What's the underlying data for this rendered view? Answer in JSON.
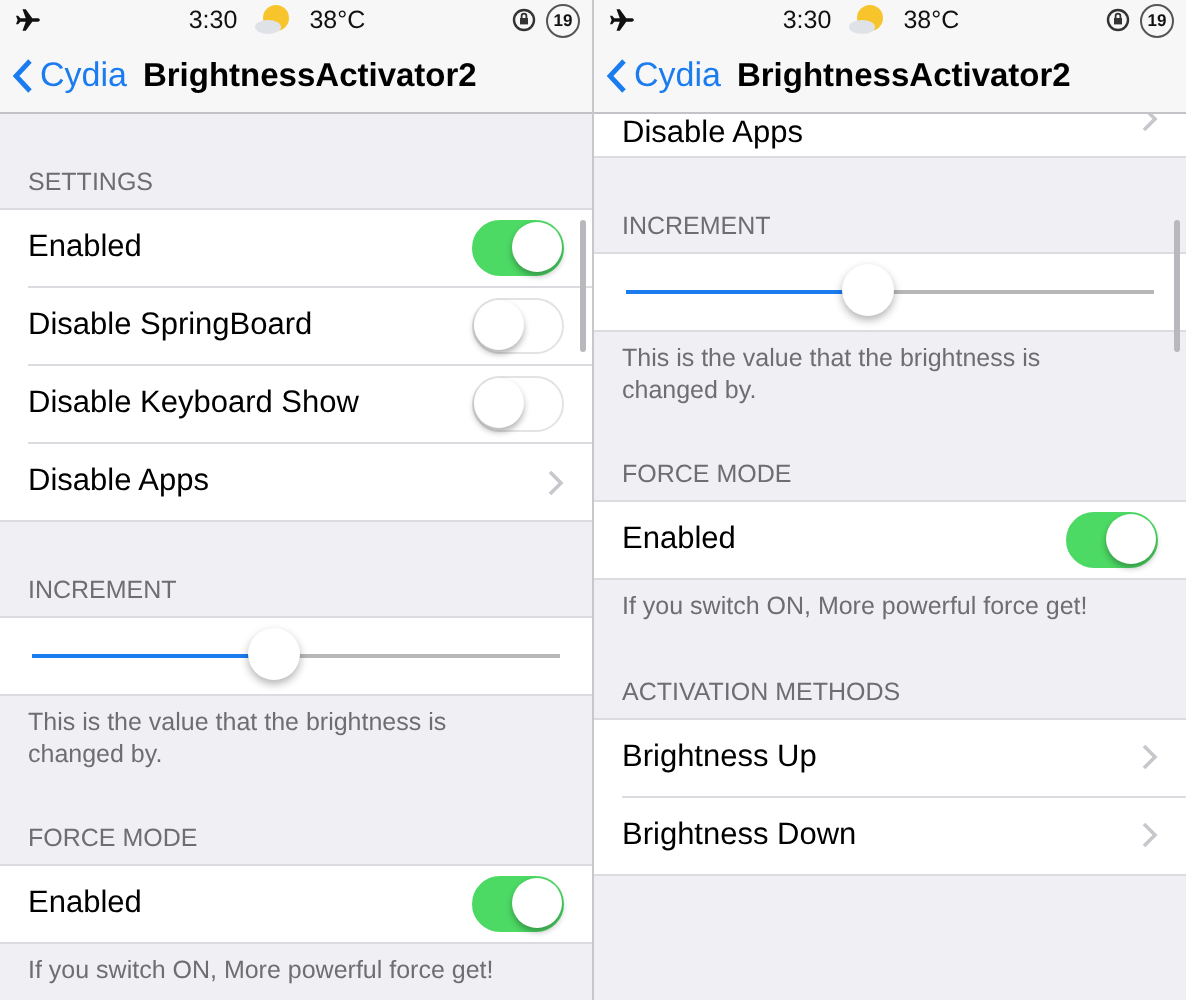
{
  "screens": [
    {
      "scrolled": false,
      "status_bar": {
        "time": "3:30",
        "temperature": "38°C",
        "badge": "19"
      },
      "nav": {
        "back": "Cydia",
        "title": "BrightnessActivator2"
      },
      "sections": [
        {
          "header": "SETTINGS",
          "rows": [
            {
              "kind": "toggle",
              "label": "Enabled",
              "on": true
            },
            {
              "kind": "toggle",
              "label": "Disable SpringBoard",
              "on": false
            },
            {
              "kind": "toggle",
              "label": "Disable Keyboard Show",
              "on": false
            },
            {
              "kind": "link",
              "label": "Disable Apps"
            }
          ]
        },
        {
          "header": "INCREMENT",
          "rows": [
            {
              "kind": "slider",
              "level": 0.46
            }
          ],
          "footer": "This is the value that the brightness is changed by."
        },
        {
          "header": "FORCE MODE",
          "rows": [
            {
              "kind": "toggle",
              "label": "Enabled",
              "on": true
            }
          ],
          "footer": "If you switch ON, More powerful force get!"
        }
      ]
    },
    {
      "scrolled": true,
      "status_bar": {
        "time": "3:30",
        "temperature": "38°C",
        "badge": "19"
      },
      "nav": {
        "back": "Cydia",
        "title": "BrightnessActivator2"
      },
      "sections": [
        {
          "rows": [
            {
              "kind": "link",
              "label": "Disable Apps"
            }
          ]
        },
        {
          "header": "INCREMENT",
          "rows": [
            {
              "kind": "slider",
              "level": 0.46
            }
          ],
          "footer": "This is the value that the brightness is changed by."
        },
        {
          "header": "FORCE MODE",
          "rows": [
            {
              "kind": "toggle",
              "label": "Enabled",
              "on": true
            }
          ],
          "footer": "If you switch ON, More powerful force get!"
        },
        {
          "header": "ACTIVATION METHODS",
          "rows": [
            {
              "kind": "link",
              "label": "Brightness Up"
            },
            {
              "kind": "link",
              "label": "Brightness Down"
            }
          ]
        }
      ]
    }
  ]
}
